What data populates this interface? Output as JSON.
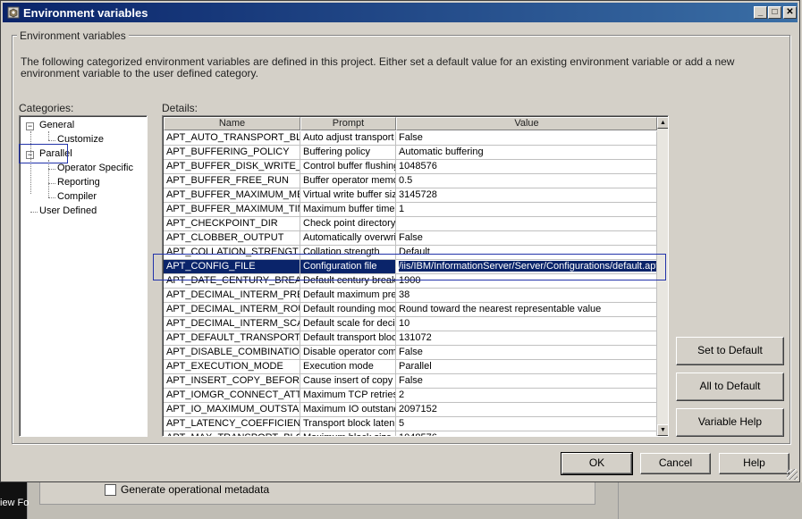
{
  "window": {
    "title": "Environment variables",
    "controls": [
      "minimize",
      "maximize",
      "close"
    ]
  },
  "group_label": "Environment variables",
  "description": "The following categorized environment variables are defined in this project.  Either set a default value for an existing environment variable or add a new environment variable to the user defined category.",
  "categories": {
    "label": "Categories:",
    "items": [
      {
        "label": "General",
        "level": 0,
        "expander": "−"
      },
      {
        "label": "Customize",
        "level": 1
      },
      {
        "label": "Parallel",
        "level": 0,
        "expander": "−",
        "highlighted": true
      },
      {
        "label": "Operator Specific",
        "level": 1
      },
      {
        "label": "Reporting",
        "level": 1
      },
      {
        "label": "Compiler",
        "level": 1
      },
      {
        "label": "User Defined",
        "level": 0
      }
    ]
  },
  "details": {
    "label": "Details:",
    "columns": [
      "Name",
      "Prompt",
      "Value"
    ],
    "rows": [
      {
        "name": "APT_AUTO_TRANSPORT_BL",
        "prompt": "Auto adjust transport l",
        "value": "False"
      },
      {
        "name": "APT_BUFFERING_POLICY",
        "prompt": "Buffering policy",
        "value": "Automatic buffering"
      },
      {
        "name": "APT_BUFFER_DISK_WRITE_",
        "prompt": "Control buffer flushing",
        "value": "1048576"
      },
      {
        "name": "APT_BUFFER_FREE_RUN",
        "prompt": "Buffer operator memo",
        "value": "0.5"
      },
      {
        "name": "APT_BUFFER_MAXIMUM_ME",
        "prompt": "Virtual write buffer size",
        "value": "3145728"
      },
      {
        "name": "APT_BUFFER_MAXIMUM_TIM",
        "prompt": "Maximum buffer timeo",
        "value": "1"
      },
      {
        "name": "APT_CHECKPOINT_DIR",
        "prompt": "Check point directory",
        "value": ""
      },
      {
        "name": "APT_CLOBBER_OUTPUT",
        "prompt": "Automatically overwrit",
        "value": "False"
      },
      {
        "name": "APT_COLLATION_STRENGT",
        "prompt": "Collation strength",
        "value": "Default"
      },
      {
        "name": "APT_CONFIG_FILE",
        "prompt": "Configuration file",
        "value": "/iis/IBM/InformationServer/Server/Configurations/default.apt",
        "selected": true
      },
      {
        "name": "APT_DATE_CENTURY_BREA",
        "prompt": "Default century break",
        "value": "1900"
      },
      {
        "name": "APT_DECIMAL_INTERM_PRE",
        "prompt": "Default maximum prec",
        "value": "38"
      },
      {
        "name": "APT_DECIMAL_INTERM_ROU",
        "prompt": "Default rounding mod",
        "value": "Round toward the nearest representable value"
      },
      {
        "name": "APT_DECIMAL_INTERM_SCA",
        "prompt": "Default scale for decin",
        "value": "10"
      },
      {
        "name": "APT_DEFAULT_TRANSPORT",
        "prompt": "Default transport bloc",
        "value": "131072"
      },
      {
        "name": "APT_DISABLE_COMBINATIO",
        "prompt": "Disable operator coml",
        "value": "False"
      },
      {
        "name": "APT_EXECUTION_MODE",
        "prompt": "Execution mode",
        "value": "Parallel"
      },
      {
        "name": "APT_INSERT_COPY_BEFORI",
        "prompt": "Cause insert of copy b",
        "value": "False"
      },
      {
        "name": "APT_IOMGR_CONNECT_ATT",
        "prompt": "Maximum TCP retries",
        "value": "2"
      },
      {
        "name": "APT_IO_MAXIMUM_OUTSTA",
        "prompt": "Maximum IO outstand",
        "value": "2097152"
      },
      {
        "name": "APT_LATENCY_COEFFICIEN",
        "prompt": "Transport block laten",
        "value": "5"
      },
      {
        "name": "APT_MAX_TRANSPORT_BLO",
        "prompt": "Maximum block size",
        "value": "1048576"
      }
    ]
  },
  "side_buttons": {
    "set_default": "Set to Default",
    "all_default": "All to Default",
    "variable_help": "Variable Help"
  },
  "footer": {
    "ok": "OK",
    "cancel": "Cancel",
    "help": "Help"
  },
  "background": {
    "checkbox_label": "Generate operational metadata",
    "taskbar_text": "iew Fo"
  },
  "colors": {
    "title_gradient_start": "#0a246a",
    "selection": "#0a246a",
    "focus_outline": "#2233aa"
  }
}
